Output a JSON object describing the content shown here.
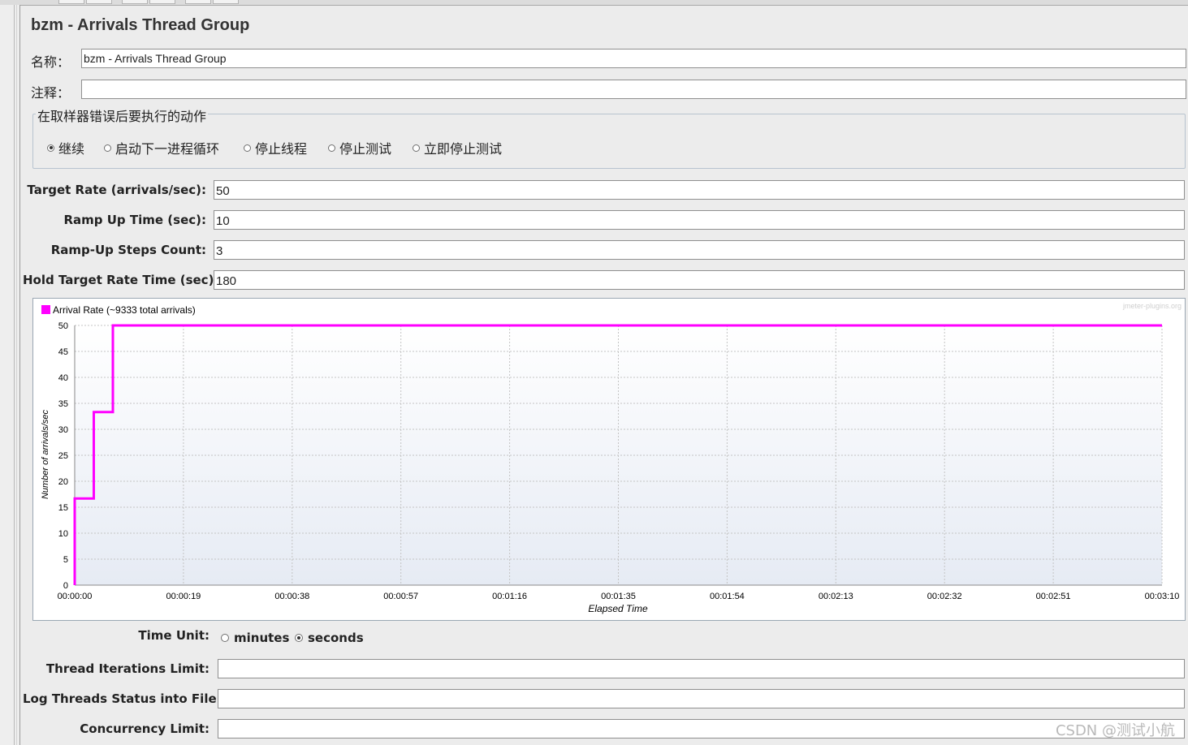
{
  "title": "bzm - Arrivals Thread Group",
  "name_field": {
    "label": "名称：",
    "value": "bzm - Arrivals Thread Group"
  },
  "comment_field": {
    "label": "注释：",
    "value": ""
  },
  "error_action": {
    "title": "在取样器错误后要执行的动作",
    "options": [
      {
        "label": "继续",
        "selected": true
      },
      {
        "label": "启动下一进程循环",
        "selected": false
      },
      {
        "label": "停止线程",
        "selected": false
      },
      {
        "label": "停止测试",
        "selected": false
      },
      {
        "label": "立即停止测试",
        "selected": false
      }
    ]
  },
  "params": [
    {
      "label": "Target Rate (arrivals/sec):",
      "value": "50"
    },
    {
      "label": "Ramp Up Time (sec):",
      "value": "10"
    },
    {
      "label": "Ramp-Up Steps Count:",
      "value": "3"
    },
    {
      "label": "Hold Target Rate Time (sec):",
      "value": "180"
    }
  ],
  "chart_data": {
    "type": "line",
    "legend": "Arrival Rate (~9333 total arrivals)",
    "series_color": "#ff00ff",
    "watermark": "jmeter-plugins.org",
    "xlabel": "Elapsed Time",
    "ylabel": "Number of arrivals/sec",
    "x_ticks": [
      "00:00:00",
      "00:00:19",
      "00:00:38",
      "00:00:57",
      "00:01:16",
      "00:01:35",
      "00:01:54",
      "00:02:13",
      "00:02:32",
      "00:02:51",
      "00:03:10"
    ],
    "y_ticks": [
      0,
      5,
      10,
      15,
      20,
      25,
      30,
      35,
      40,
      45,
      50
    ],
    "xlim": [
      0,
      190
    ],
    "ylim": [
      0,
      50
    ],
    "grid": true,
    "points": [
      [
        0,
        0
      ],
      [
        0,
        16.67
      ],
      [
        3.33,
        16.67
      ],
      [
        3.33,
        33.33
      ],
      [
        6.67,
        33.33
      ],
      [
        6.67,
        50
      ],
      [
        190,
        50
      ]
    ]
  },
  "time_unit": {
    "label": "Time Unit:",
    "options": [
      {
        "label": "minutes",
        "selected": false
      },
      {
        "label": "seconds",
        "selected": true
      }
    ]
  },
  "extras": [
    {
      "label": "Thread Iterations Limit:",
      "value": ""
    },
    {
      "label": "Log Threads Status into File:",
      "value": ""
    },
    {
      "label": "Concurrency Limit:",
      "value": ""
    }
  ],
  "watermark": "CSDN @测试小航"
}
